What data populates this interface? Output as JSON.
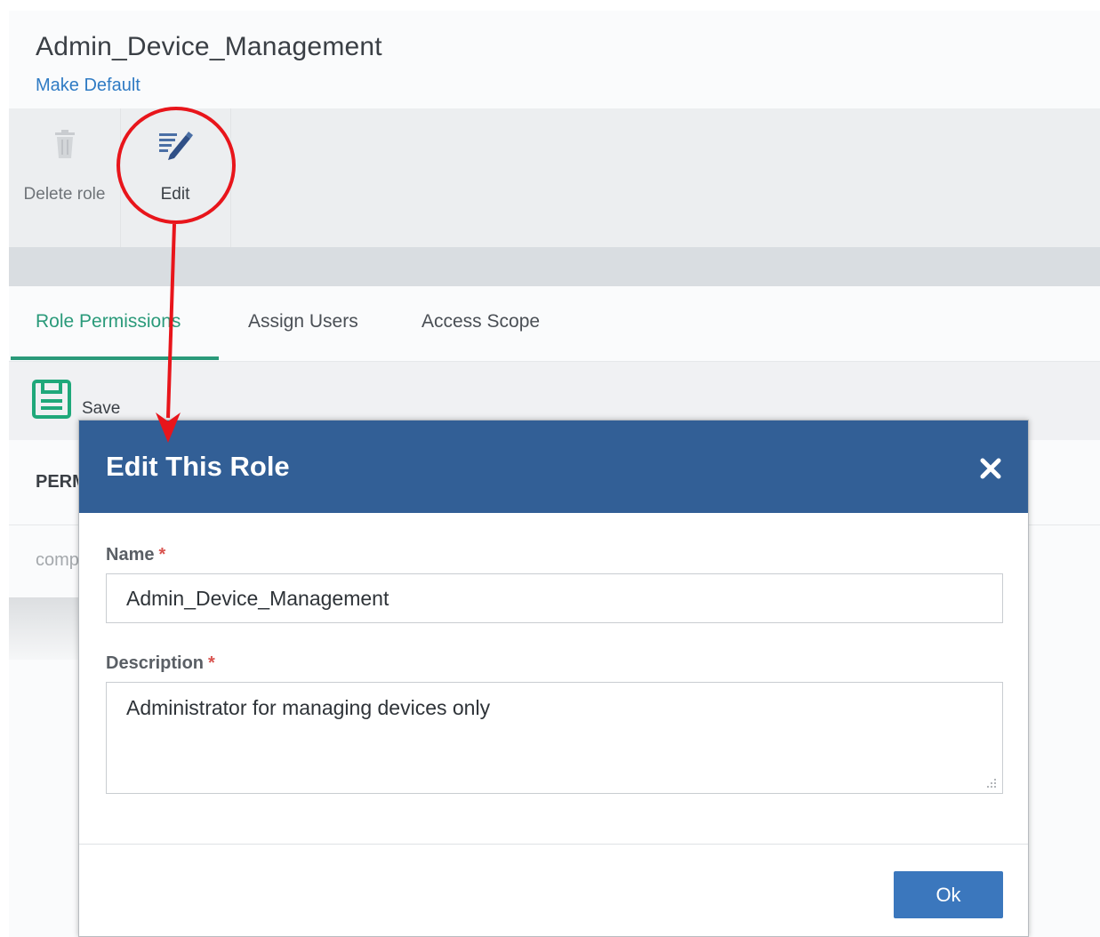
{
  "page": {
    "title": "Admin_Device_Management",
    "make_default_label": "Make Default"
  },
  "toolbar": {
    "delete_role_label": "Delete role",
    "edit_label": "Edit"
  },
  "tabs": [
    {
      "label": "Role Permissions",
      "active": true
    },
    {
      "label": "Assign Users",
      "active": false
    },
    {
      "label": "Access Scope",
      "active": false
    }
  ],
  "save_label": "Save",
  "permissions_header_partial": "PERM",
  "row_partial": "comp",
  "modal": {
    "title": "Edit This Role",
    "name_label": "Name",
    "name_value": "Admin_Device_Management",
    "description_label": "Description",
    "description_value": "Administrator for managing devices only",
    "required_mark": "*",
    "ok_label": "Ok"
  },
  "colors": {
    "modal_header": "#325f96",
    "active_tab": "#2a9a7a",
    "link": "#2f7bc4",
    "ok_button": "#3b77bd",
    "annotation": "#e8151b"
  },
  "icons": [
    "trash-icon",
    "edit-pencil-icon",
    "save-disk-icon",
    "close-icon",
    "resize-grip-icon"
  ]
}
